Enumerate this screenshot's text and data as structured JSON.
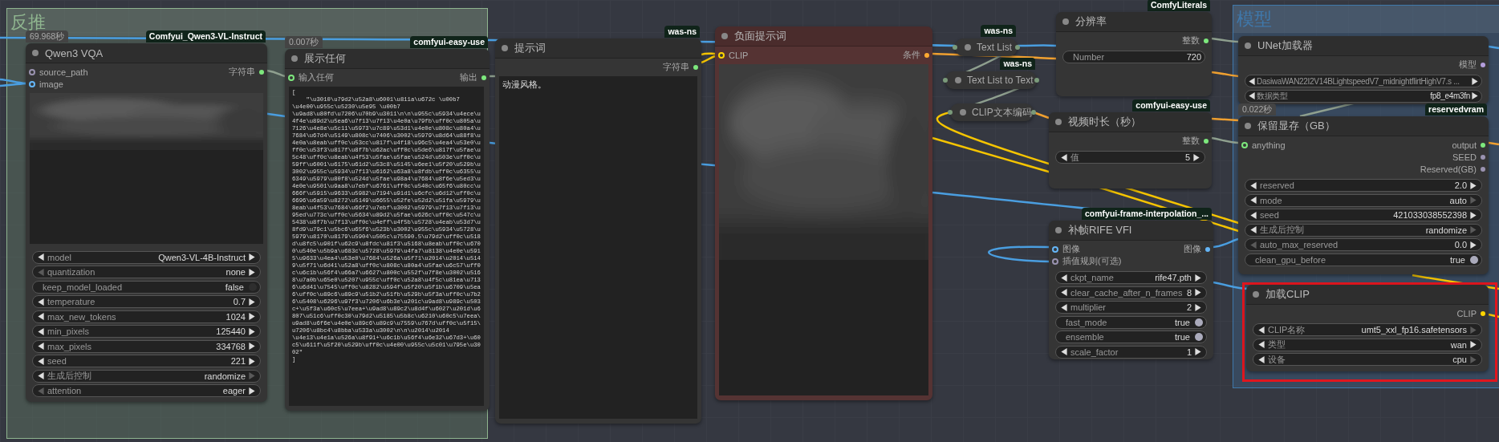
{
  "groups": [
    {
      "title": "反推",
      "color": "#8fb58f"
    },
    {
      "title": "模型",
      "color": "#3f78ab"
    }
  ],
  "nodes": [
    {
      "kind": "full",
      "title": "Qwen3 VQA",
      "color": "#353535",
      "badge": "69.968秒",
      "tag": "Comfyui_Qwen3-VL-Instruct",
      "highlighted": false,
      "inputs": [
        {
          "name": "source_path",
          "color": "#9a93b0"
        },
        {
          "name": "image",
          "color": "#64b5f6"
        }
      ],
      "outputs": [
        {
          "name": "字符串",
          "color": "#7de87d"
        }
      ],
      "content": {
        "kind": "picture"
      },
      "widgets": [
        {
          "kind": "combo",
          "label": "model",
          "value": "Qwen3-VL-4B-Instruct",
          "prev_disabled": false,
          "next_disabled": false
        },
        {
          "kind": "combo",
          "label": "quantization",
          "value": "none",
          "prev_disabled": true,
          "next_disabled": false
        },
        {
          "kind": "toggle",
          "label": "keep_model_loaded",
          "value": "false",
          "on": false
        },
        {
          "kind": "combo",
          "label": "temperature",
          "value": "0.7",
          "prev_disabled": false,
          "next_disabled": false
        },
        {
          "kind": "combo",
          "label": "max_new_tokens",
          "value": "1024",
          "prev_disabled": false,
          "next_disabled": false
        },
        {
          "kind": "combo",
          "label": "min_pixels",
          "value": "125440",
          "prev_disabled": false,
          "next_disabled": false
        },
        {
          "kind": "combo",
          "label": "max_pixels",
          "value": "334768",
          "prev_disabled": false,
          "next_disabled": false
        },
        {
          "kind": "combo",
          "label": "seed",
          "value": "221",
          "prev_disabled": false,
          "next_disabled": false
        },
        {
          "kind": "combo",
          "label": "生成后控制",
          "value": "randomize",
          "prev_disabled": false,
          "next_disabled": true
        },
        {
          "kind": "combo",
          "label": "attention",
          "value": "eager",
          "prev_disabled": true,
          "next_disabled": false
        }
      ]
    },
    {
      "kind": "full",
      "title": "展示任何",
      "color": "#353535",
      "badge": "0.007秒",
      "tag": "comfyui-easy-use",
      "highlighted": false,
      "inputs": [
        {
          "name": "输入任何",
          "color": "#7de87d"
        }
      ],
      "outputs": [
        {
          "name": "输出",
          "color": "#7de87d"
        }
      ],
      "content": {
        "kind": "text",
        "text": "[\n    \"\\u3010\\u79d2\\u52a8\\u6001\\u811a\\u672c \\u00b7 \\u4e00\\u955c\\u5230\\u5e95 \\u00b7 \\u9ad8\\u80fd\\u7206\\u70b9\\u3011\\n\\n\\u955c\\u5934\\u4ece\\u4f4e\\u89d2\\u5ea6\\u7f13\\u7f13\\u4e0a\\u79fb\\uff0c\\u805a\\u7126\\u4e8e\\u5c11\\u5973\\u7c89\\u53d1\\u4e0e\\u808c\\u80a4\\u7684\\u67d4\\u5149\\u808c\\u7406\\u3002\\u5979\\u8d64\\u88f8\\u4e0a\\u8eab\\uff0c\\u53cc\\u817f\\u4f18\\u96c5\\u4ea4\\u53e0\\uff0c\\u53f3\\u817f\\u8f7b\\u62ac\\uff0c\\u5de6\\u817f\\u5fae\\u5c48\\uff0c\\u8eab\\u4f53\\u5fae\\u5fae\\u524d\\u503e\\uff0c\\u59ff\\u6001\\u6175\\u61d2\\u53c8\\u5145\\u6ee1\\u5f20\\u529b\\u3002\\u955c\\u5934\\u7f13\\u6162\\u63a8\\u8fdb\\uff0c\\u6355\\u6349\\u5979\\u80f8\\u524d\\u5fae\\u98a4\\u7684\\u8f6e\\u5ed3\\u4e0e\\u9501\\u9aa8\\u7ebf\\u6761\\uff0c\\u540c\\u65f6\\u80cc\\u666f\\u5915\\u9633\\u5982\\u7194\\u91d1\\u6cfc\\u6d12\\uff0c\\u6696\\u6a59\\u8272\\u5149\\u6655\\u52fe\\u52d2\\u51fa\\u5979\\u8eab\\u4f53\\u7684\\u66f2\\u7ebf\\u3002\\u5979\\u7f13\\u7f13\\u95ed\\u773c\\uff0c\\u5634\\u89d2\\u5fae\\u626c\\uff0c\\u547c\\u5438\\u8f7b\\u7f13\\uff0c\\u4eff\\u4f5b\\u5728\\u4eab\\u53d7\\u8fd9\\u79c1\\u5bc6\\u65f6\\u523b\\u3002\\u955c\\u5934\\u5728\\u5979\\u8170\\u8179\\u5904\\u505c\\u75590.5\\u79d2\\uff0c\\u518d\\u8fc5\\u901f\\u62c9\\u8fdc\\u81f3\\u5168\\u8eab\\uff0c\\u6700\\u540e\\u5b9a\\u683c\\u5728\\u5979\\u4fa7\\u8138\\u4e0e\\u5915\\u9633\\u4ea4\\u53e0\\u7684\\u526a\\u5f71\\u2014\\u2014\\u5149\\u5f71\\u6d41\\u52a8\\uff0c\\u808c\\u80a4\\u5fae\\u6c57\\uff0c\\u6c1b\\u56f4\\u66a7\\u6627\\u800c\\u552f\\u7f8e\\u3002\\u5168\\u7a0b\\u65e0\\u5207\\u955c\\uff0c\\u52a8\\u4f5c\\u81ea\\u7136\\u6d41\\u7545\\uff0c\\u8282\\u594f\\u5f20\\u5f1b\\u6709\\u5ea6\\uff0c\\u89c6\\u89c9\\u51b2\\u51fb\\u529b\\u5f3a\\uff0c\\u7b26\\u5408\\u6296\\u97f3\\u7206\\u6b3e\\u201c\\u9ad8\\u989c\\u503c+\\u5f3a\\u60c5\\u7eea+\\u9ad8\\u89c2\\u8d4f\\u6027\\u201d\\u6807\\u51c6\\uff0c30\\u79d2\\u5185\\u5b8c\\u6210\\u60c5\\u7eea\\u9ad8\\u6f6e\\u4e0e\\u89c6\\u89c9\\u7559\\u767d\\uff0c\\u5f15\\u7206\\u8bc4\\u8bba\\u533a\\u3002\\n\\n\\u2014\\u2014 \\u4e13\\u4e1a\\u526a\\u8f91+\\u6c1b\\u56f4\\u6e32\\u67d3+\\u60c5\\u611f\\u5f20\\u529b\\uff0c\\u4e00\\u955c\\u5c01\\u795e\\u3002\"\n]"
      }
    },
    {
      "kind": "full",
      "title": "提示词",
      "color": "#353535",
      "tag": "was-ns",
      "highlighted": false,
      "outputs": [
        {
          "name": "字符串",
          "color": "#7de87d"
        }
      ],
      "content": {
        "kind": "text",
        "text": "动漫风格。"
      }
    },
    {
      "kind": "full",
      "title": "负面提示词",
      "color": "#553333",
      "highlighted": false,
      "inputs": [
        {
          "name": "CLIP",
          "color": "#ffd500"
        }
      ],
      "outputs": [
        {
          "name": "条件",
          "color": "#ffa931"
        }
      ],
      "content": {
        "kind": "picture"
      }
    },
    {
      "kind": "collapsed",
      "title": "Text List",
      "color": "#353535",
      "tag": "was-ns",
      "highlighted": false,
      "inputs": [
        {
          "color": "#7a9a7a"
        }
      ],
      "outputs": [
        {
          "color": "#7a9a7a"
        }
      ]
    },
    {
      "kind": "collapsed",
      "title": "Text List to Text",
      "color": "#353535",
      "tag": "was-ns",
      "highlighted": false,
      "inputs": [
        {
          "color": "#7a9a7a"
        }
      ],
      "outputs": [
        {
          "color": "#7a9a7a"
        }
      ]
    },
    {
      "kind": "collapsed",
      "title": "CLIP文本编码",
      "color": "#353535",
      "highlighted": false,
      "inputs": [
        {
          "color": "#7a9a7a"
        }
      ],
      "outputs": [
        {
          "color": "#7a9a7a"
        }
      ]
    },
    {
      "kind": "full",
      "title": "分辨率",
      "color": "#353535",
      "tag": "ComfyLiterals",
      "highlighted": false,
      "outputs": [
        {
          "name": "整数",
          "color": "#7de87d"
        }
      ],
      "widgets": [
        {
          "kind": "field",
          "label": "Number",
          "value": "720"
        }
      ]
    },
    {
      "kind": "full",
      "title": "视频时长（秒）",
      "color": "#353535",
      "tag": "comfyui-easy-use",
      "highlighted": false,
      "outputs": [
        {
          "name": "整数",
          "color": "#7de87d"
        }
      ],
      "widgets": [
        {
          "kind": "combo",
          "label": "值",
          "value": "5",
          "prev_disabled": false,
          "next_disabled": false
        }
      ]
    },
    {
      "kind": "full",
      "title": "补帧RIFE VFI",
      "color": "#353535",
      "tag": "comfyui-frame-interpolation_...",
      "highlighted": false,
      "inputs": [
        {
          "name": "图像",
          "color": "#64b5f6"
        },
        {
          "name": "插值规则(可选)",
          "color": "#9a93b0"
        }
      ],
      "outputs": [
        {
          "name": "图像",
          "color": "#64b5f6"
        }
      ],
      "widgets": [
        {
          "kind": "combo",
          "label": "ckpt_name",
          "value": "rife47.pth",
          "prev_disabled": false,
          "next_disabled": false
        },
        {
          "kind": "combo",
          "label": "clear_cache_after_n_frames",
          "value": "8",
          "prev_disabled": false,
          "next_disabled": false
        },
        {
          "kind": "combo",
          "label": "multiplier",
          "value": "2",
          "prev_disabled": false,
          "next_disabled": false
        },
        {
          "kind": "toggle",
          "label": "fast_mode",
          "value": "true",
          "on": true
        },
        {
          "kind": "toggle",
          "label": "ensemble",
          "value": "true",
          "on": true
        },
        {
          "kind": "combo",
          "label": "scale_factor",
          "value": "1",
          "prev_disabled": false,
          "next_disabled": false
        }
      ]
    },
    {
      "kind": "full",
      "title": "UNet加载器",
      "color": "#353535",
      "highlighted": false,
      "outputs": [
        {
          "name": "模型",
          "color": "#b39ddb"
        }
      ],
      "widgets": [
        {
          "kind": "combo",
          "label": "DasiwaWAN22I2V14BLightspeedV7_midnightflirtHighV7.s ...",
          "prev_disabled": false,
          "next_disabled": false
        },
        {
          "kind": "combo",
          "label": "数据类型",
          "value": "fp8_e4m3fn",
          "prev_disabled": false,
          "next_disabled": false
        }
      ]
    },
    {
      "kind": "full",
      "title": "保留显存（GB）",
      "color": "#353535",
      "badge": "0.022秒",
      "tag": "reservedvram",
      "highlighted": false,
      "inputs": [
        {
          "name": "anything",
          "color": "#7de87d"
        }
      ],
      "outputs": [
        {
          "name": "output",
          "color": "#7de87d"
        },
        {
          "name": "SEED",
          "color": "#9a93b0"
        },
        {
          "name": "Reserved(GB)",
          "color": "#9a93b0"
        }
      ],
      "widgets": [
        {
          "kind": "combo",
          "label": "reserved",
          "value": "2.0",
          "prev_disabled": false,
          "next_disabled": false
        },
        {
          "kind": "combo",
          "label": "mode",
          "value": "auto",
          "prev_disabled": false,
          "next_disabled": true
        },
        {
          "kind": "combo",
          "label": "seed",
          "value": "421033038552398",
          "prev_disabled": false,
          "next_disabled": false
        },
        {
          "kind": "combo",
          "label": "生成后控制",
          "value": "randomize",
          "prev_disabled": false,
          "next_disabled": true
        },
        {
          "kind": "combo",
          "label": "auto_max_reserved",
          "value": "0.0",
          "prev_disabled": true,
          "next_disabled": false
        },
        {
          "kind": "toggle",
          "label": "clean_gpu_before",
          "value": "true",
          "on": true
        }
      ]
    },
    {
      "kind": "full",
      "title": "加载CLIP",
      "color": "#353535",
      "highlighted": true,
      "outputs": [
        {
          "name": "CLIP",
          "color": "#ffd500"
        }
      ],
      "widgets": [
        {
          "kind": "combo",
          "label": "CLIP名称",
          "value": "umt5_xxl_fp16.safetensors",
          "prev_disabled": false,
          "next_disabled": true
        },
        {
          "kind": "combo",
          "label": "类型",
          "value": "wan",
          "prev_disabled": false,
          "next_disabled": false
        },
        {
          "kind": "combo",
          "label": "设备",
          "value": "cpu",
          "prev_disabled": false,
          "next_disabled": true
        }
      ]
    }
  ]
}
